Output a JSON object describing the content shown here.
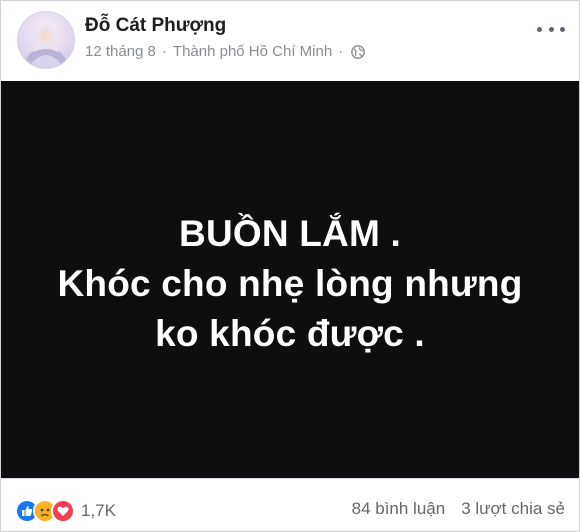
{
  "post": {
    "author": "Đỗ Cát Phượng",
    "date": "12 tháng 8",
    "separator": "·",
    "location": "Thành phố Hồ Chí Minh",
    "separator2": "·",
    "privacy_icon": "globe-icon",
    "more_icon": "more-options-icon",
    "image_text": [
      "BUỒN LẮM .",
      "Khóc cho nhẹ lòng nhưng",
      "ko khóc được ."
    ],
    "reaction_icons": [
      "like-icon",
      "sad-icon",
      "love-icon"
    ],
    "reactions_count": "1,7K",
    "comments": "84 bình luận",
    "shares": "3 lượt chia sẻ"
  },
  "colors": {
    "image_bg": "#0e0e0e",
    "like": "#1877f2",
    "sad": "#f7b125",
    "love": "#f33e58"
  }
}
